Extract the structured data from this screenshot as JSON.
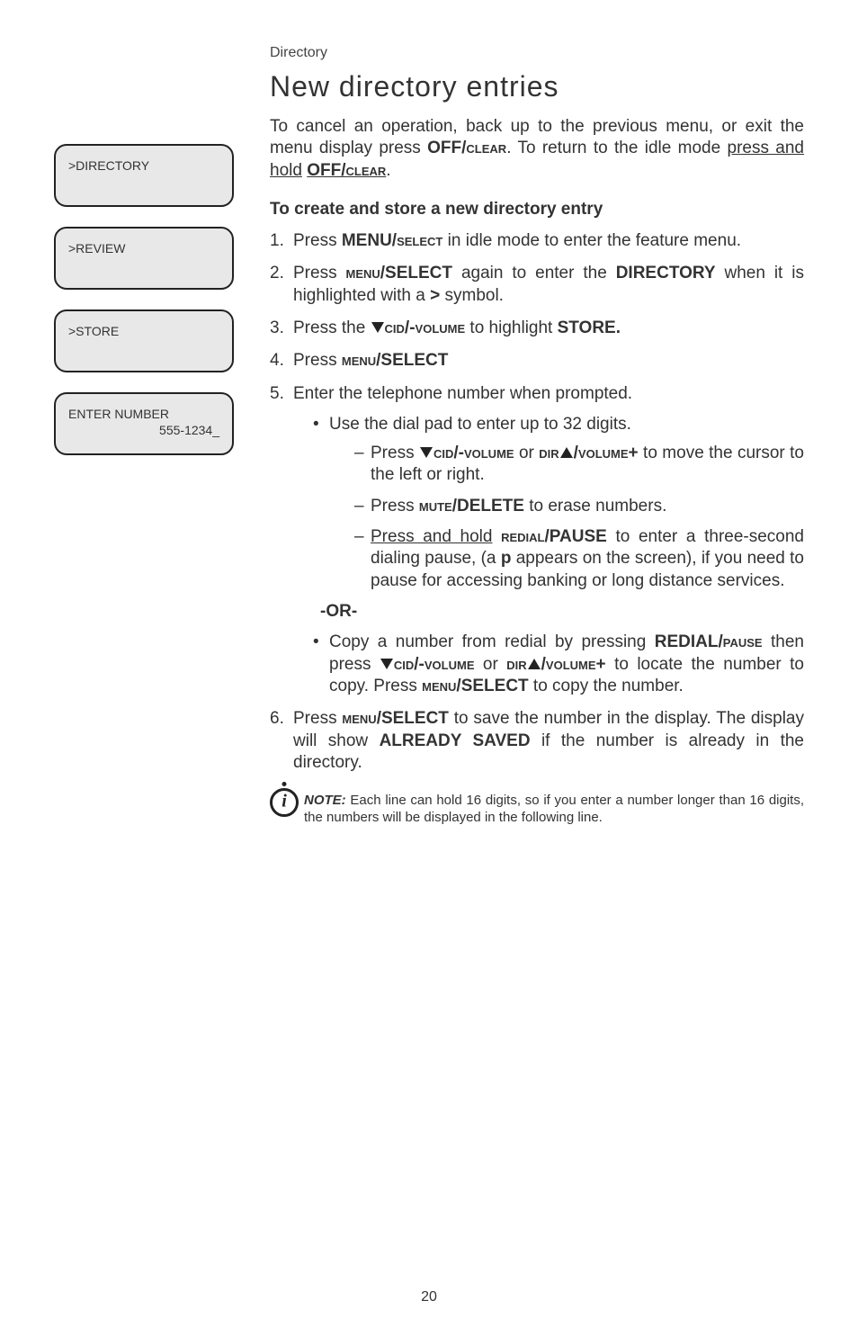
{
  "header": {
    "section_label": "Directory"
  },
  "title": "New directory entries",
  "intro": {
    "part1": "To cancel an operation, back up to the previous menu, or exit the menu display press ",
    "offclear1a": "OFF/",
    "offclear1b": "clear",
    "part2": ". To return to the idle mode ",
    "pressandhold": "press and hold",
    "space": " ",
    "offclear2a": "OFF/",
    "offclear2b": "clear",
    "period": "."
  },
  "subhead": "To create and store a new directory entry",
  "steps": {
    "s1a": "Press ",
    "s1b": "MENU/",
    "s1c": "select",
    "s1d": " in idle mode to enter the feature menu.",
    "s2a": "Press ",
    "s2b": "menu",
    "s2c": "/SELECT",
    "s2d": " again to enter the ",
    "s2e": "DIRECTORY",
    "s2f": " when it is highlighted with a ",
    "s2g": ">",
    "s2h": " symbol.",
    "s3a": "Press the ",
    "s3b": "cid/-volume",
    "s3c": " to highlight ",
    "s3d": "STORE.",
    "s4a": "Press ",
    "s4b": "menu",
    "s4c": "/SELECT",
    "s5": "Enter the telephone number when prompted.",
    "s5_b1": "Use the dial pad to enter up to 32 digits.",
    "s5_d1a": "Press ",
    "s5_d1b": "cid/-volume",
    "s5_d1c": " or ",
    "s5_d1d": "dir",
    "s5_d1e": "/volume+",
    "s5_d1f": " to move the cursor to the left or right.",
    "s5_d2a": "Press ",
    "s5_d2b": "mute",
    "s5_d2c": "/DELETE",
    "s5_d2d": " to erase numbers.",
    "s5_d3a": "Press and hold",
    "s5_d3b": " ",
    "s5_d3c": "redial",
    "s5_d3d": "/PAUSE",
    "s5_d3e": " to enter a three-second dialing pause, (a ",
    "s5_d3f": "p",
    "s5_d3g": " appears on the screen), if you need to pause for accessing banking or long distance services.",
    "or": "-OR-",
    "s5_b2a": "Copy a number from redial by pressing ",
    "s5_b2b": "REDIAL",
    "s5_b2c": "/pause",
    "s5_b2d": " then press ",
    "s5_b2e": "cid/-volume",
    "s5_b2f": " or ",
    "s5_b2g": "dir",
    "s5_b2h": "/volume+",
    "s5_b2i": " to locate the number to copy. Press ",
    "s5_b2j": "menu",
    "s5_b2k": "/SELECT",
    "s5_b2l": " to copy the number.",
    "s6a": "Press ",
    "s6b": "menu",
    "s6c": "/SELECT",
    "s6d": " to save the number in the display. The display will show ",
    "s6e": "ALREADY SAVED",
    "s6f": " if the number is already in the directory."
  },
  "note": {
    "label": "NOTE:",
    "text": " Each line can hold 16 digits, so if you enter a number longer than 16 digits, the numbers will be displayed in the following line."
  },
  "page_number": "20",
  "sidebar": {
    "screens": [
      {
        "line1": ">DIRECTORY",
        "line2": ""
      },
      {
        "line1": ">REVIEW",
        "line2": ""
      },
      {
        "line1": ">STORE",
        "line2": ""
      },
      {
        "line1": "ENTER NUMBER",
        "line2": "555-1234_"
      }
    ]
  }
}
